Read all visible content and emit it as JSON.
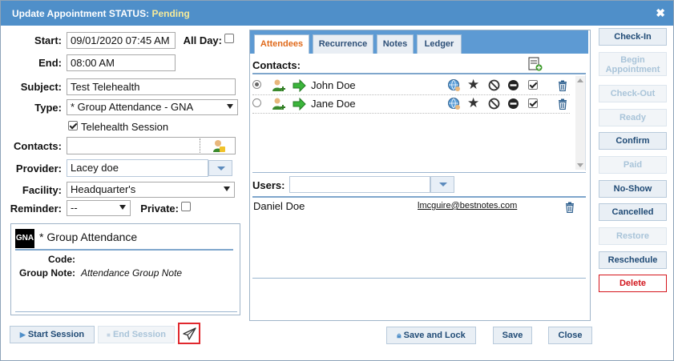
{
  "window": {
    "title_prefix": "Update Appointment STATUS:",
    "status": "Pending",
    "close_glyph": "✖"
  },
  "form": {
    "start_label": "Start:",
    "start_value": "09/01/2020 07:45 AM",
    "allday_label": "All Day:",
    "allday_checked": false,
    "end_label": "End:",
    "end_value": "08:00 AM",
    "subject_label": "Subject:",
    "subject_value": "Test Telehealth",
    "type_label": "Type:",
    "type_value": "* Group Attendance - GNA",
    "telehealth_label": "Telehealth Session",
    "telehealth_checked": true,
    "contacts_label": "Contacts:",
    "contacts_value": "",
    "provider_label": "Provider:",
    "provider_value": "Lacey doe",
    "facility_label": "Facility:",
    "facility_value": "Headquarter's",
    "reminder_label": "Reminder:",
    "reminder_value": "--",
    "private_label": "Private:",
    "private_checked": false
  },
  "group_note": {
    "badge": "GNA",
    "title": "* Group Attendance",
    "code_label": "Code:",
    "code_value": "",
    "note_label": "Group Note:",
    "note_value": "Attendance Group Note"
  },
  "tabs": [
    {
      "label": "Attendees",
      "active": true
    },
    {
      "label": "Recurrence",
      "active": false
    },
    {
      "label": "Notes",
      "active": false
    },
    {
      "label": "Ledger",
      "active": false
    }
  ],
  "attendees": {
    "contacts_header": "Contacts:",
    "contacts": [
      {
        "name": "John Doe",
        "selected": true,
        "checked": true
      },
      {
        "name": "Jane Doe",
        "selected": false,
        "checked": true
      }
    ],
    "users_label": "Users:",
    "users_value": "",
    "users": [
      {
        "name": "Daniel Doe",
        "email": "lmcguire@bestnotes.com"
      }
    ]
  },
  "right_buttons": [
    {
      "label": "Check-In",
      "state": "enabled"
    },
    {
      "label": "Begin Appointment",
      "state": "disabled"
    },
    {
      "label": "Check-Out",
      "state": "disabled"
    },
    {
      "label": "Ready",
      "state": "disabled"
    },
    {
      "label": "Confirm",
      "state": "enabled"
    },
    {
      "label": "Paid",
      "state": "disabled"
    },
    {
      "label": "No-Show",
      "state": "enabled"
    },
    {
      "label": "Cancelled",
      "state": "enabled"
    },
    {
      "label": "Restore",
      "state": "disabled"
    },
    {
      "label": "Reschedule",
      "state": "enabled"
    },
    {
      "label": "Delete",
      "state": "danger"
    }
  ],
  "bottom": {
    "start_session": "Start Session",
    "end_session": "End Session",
    "save_and_lock": "Save and Lock",
    "save": "Save",
    "close": "Close"
  },
  "colors": {
    "titlebar": "#4f8fc9",
    "status": "#f6ea9a",
    "tabbar": "#5d9ad3",
    "active_tab": "#e06a1b",
    "delete": "#d2161d",
    "highlight_box": "#e0282e"
  }
}
